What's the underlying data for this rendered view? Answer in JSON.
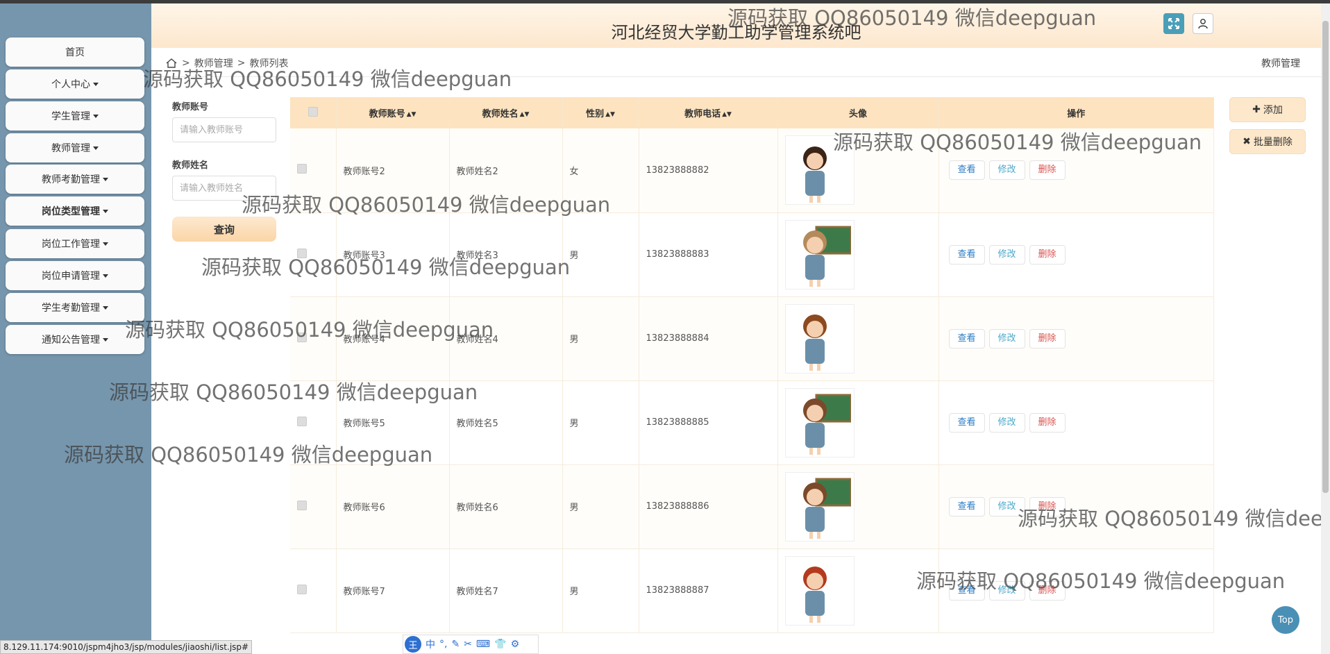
{
  "header": {
    "title": "河北经贸大学勤工助学管理系统吧"
  },
  "sidebar": {
    "items": [
      {
        "label": "首页",
        "dropdown": false,
        "bold": false
      },
      {
        "label": "个人中心",
        "dropdown": true,
        "bold": false
      },
      {
        "label": "学生管理",
        "dropdown": true,
        "bold": false
      },
      {
        "label": "教师管理",
        "dropdown": true,
        "bold": false
      },
      {
        "label": "教师考勤管理",
        "dropdown": true,
        "bold": false
      },
      {
        "label": "岗位类型管理",
        "dropdown": true,
        "bold": true
      },
      {
        "label": "岗位工作管理",
        "dropdown": true,
        "bold": false
      },
      {
        "label": "岗位申请管理",
        "dropdown": true,
        "bold": false
      },
      {
        "label": "学生考勤管理",
        "dropdown": true,
        "bold": false
      },
      {
        "label": "通知公告管理",
        "dropdown": true,
        "bold": false
      }
    ]
  },
  "breadcrumb": {
    "sep": ">",
    "level1": "教师管理",
    "level2": "教师列表",
    "right": "教师管理"
  },
  "search": {
    "account_label": "教师账号",
    "account_placeholder": "请输入教师账号",
    "name_label": "教师姓名",
    "name_placeholder": "请输入教师姓名",
    "query_label": "查询"
  },
  "actions": {
    "add_label": "添加",
    "batch_delete_label": "批量删除"
  },
  "table": {
    "columns": [
      "教师账号",
      "教师姓名",
      "性别",
      "教师电话",
      "头像",
      "操作"
    ],
    "rows": [
      {
        "account": "教师账号2",
        "name": "教师姓名2",
        "gender": "女",
        "phone": "13823888882",
        "avatar": "teacher-woman-glasses"
      },
      {
        "account": "教师账号3",
        "name": "教师姓名3",
        "gender": "男",
        "phone": "13823888883",
        "avatar": "teacher-blackboard"
      },
      {
        "account": "教师账号4",
        "name": "教师姓名4",
        "gender": "男",
        "phone": "13823888884",
        "avatar": "teacher-globe-pointer"
      },
      {
        "account": "教师账号5",
        "name": "教师姓名5",
        "gender": "男",
        "phone": "13823888885",
        "avatar": "teacher-green-board"
      },
      {
        "account": "教师账号6",
        "name": "教师姓名6",
        "gender": "男",
        "phone": "13823888886",
        "avatar": "teacher-green-board"
      },
      {
        "account": "教师账号7",
        "name": "教师姓名7",
        "gender": "男",
        "phone": "13823888887",
        "avatar": "teacher-red-hair"
      }
    ],
    "row_actions": {
      "view": "查看",
      "edit": "修改",
      "delete": "删除"
    }
  },
  "watermark": "源码获取 QQ86050149 微信deepguan",
  "watermark_cut": "源码获取 QQ86050149 微信deep",
  "top_button": "Top",
  "status_url": "8.129.11.174:9010/jspm4jho3/jsp/modules/jiaoshi/list.jsp#",
  "ime": {
    "logo": "王",
    "mode": "中"
  },
  "colors": {
    "sidebar_bg": "#7696ad",
    "header_bg": "#fde7cd",
    "accent": "#4a9fb8",
    "delete": "#d9534f"
  }
}
